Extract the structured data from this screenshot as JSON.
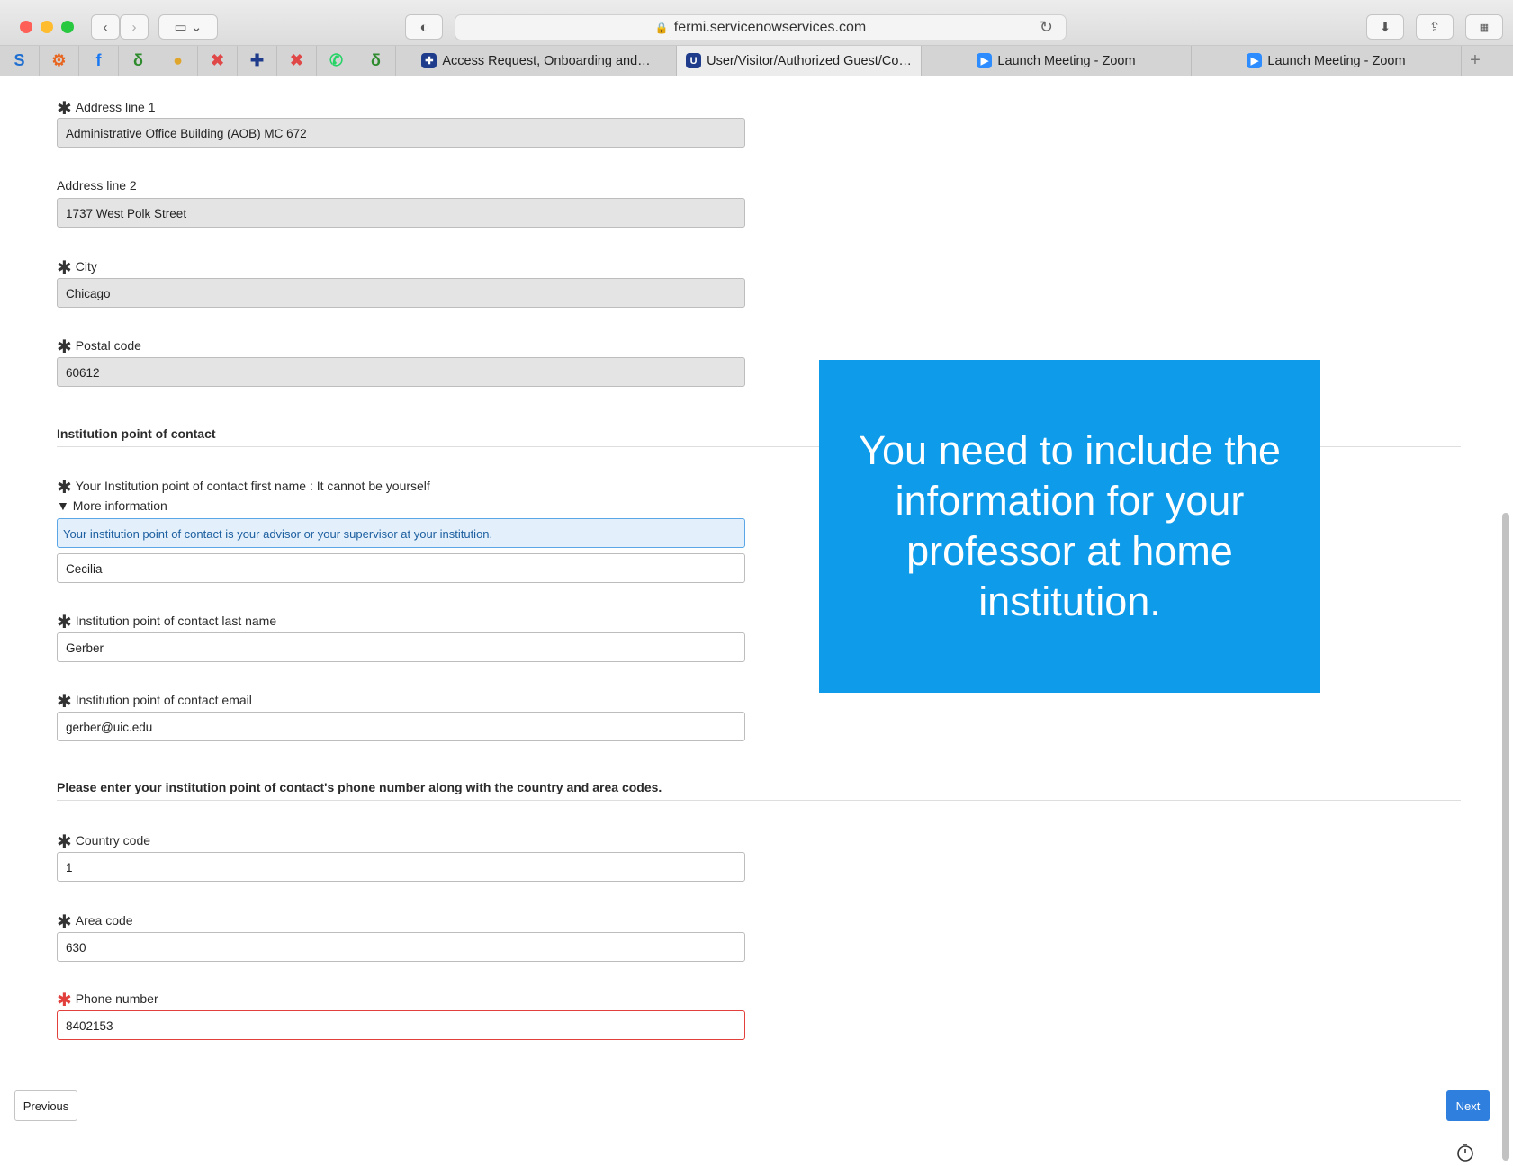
{
  "browser": {
    "url": "fermi.servicenowservices.com",
    "pinned": [
      {
        "icon": "s-icon",
        "glyph": "S",
        "color": "#1f6fd1"
      },
      {
        "icon": "gear-orange-icon",
        "glyph": "⚙",
        "color": "#e8651f"
      },
      {
        "icon": "facebook-icon",
        "glyph": "f",
        "color": "#1877f2"
      },
      {
        "icon": "sigma-icon",
        "glyph": "δ",
        "color": "#2e8b2e"
      },
      {
        "icon": "maps-pin-icon",
        "glyph": "●",
        "color": "#e0a62b"
      },
      {
        "icon": "bug-icon",
        "glyph": "✖",
        "color": "#e04848"
      },
      {
        "icon": "fermilab-icon",
        "glyph": "✚",
        "color": "#1f3c8c"
      },
      {
        "icon": "bug-icon-2",
        "glyph": "✖",
        "color": "#e04848"
      },
      {
        "icon": "whatsapp-icon",
        "glyph": "✆",
        "color": "#25d366"
      },
      {
        "icon": "sigma-icon-2",
        "glyph": "δ",
        "color": "#2e8b2e"
      }
    ],
    "tabs": [
      {
        "label": "Access Request, Onboarding and…",
        "icon": "fermilab-icon",
        "color": "#1f3c8c",
        "glyph": "✚",
        "active": false
      },
      {
        "label": "User/Visitor/Authorized Guest/Co…",
        "icon": "servicenow-icon",
        "color": "#1f3c8c",
        "glyph": "U",
        "active": true
      },
      {
        "label": "Launch Meeting - Zoom",
        "icon": "zoom-icon",
        "color": "#2d8cff",
        "glyph": "▶",
        "active": false
      },
      {
        "label": "Launch Meeting - Zoom",
        "icon": "zoom-icon",
        "color": "#2d8cff",
        "glyph": "▶",
        "active": false
      }
    ]
  },
  "form": {
    "address1": {
      "label": "Address line 1",
      "value": "Administrative Office Building (AOB) MC 672"
    },
    "address2": {
      "label": "Address line 2",
      "value": "1737 West Polk Street"
    },
    "city": {
      "label": "City",
      "value": "Chicago"
    },
    "postal": {
      "label": "Postal code",
      "value": "60612"
    },
    "contact_section": "Institution point of contact",
    "contact_first": {
      "label": "Your Institution point of contact first name : It cannot be yourself",
      "value": "Cecilia"
    },
    "more_info": "More information",
    "info_text": "Your institution point of contact is your advisor or your supervisor at your institution.",
    "contact_last": {
      "label": "Institution point of contact last name",
      "value": "Gerber"
    },
    "contact_email": {
      "label": "Institution point of contact email",
      "value": "gerber@uic.edu"
    },
    "phone_section": "Please enter your institution point of contact's phone number along with the country and area codes.",
    "country_code": {
      "label": "Country code",
      "value": "1"
    },
    "area_code": {
      "label": "Area code",
      "value": "630"
    },
    "phone": {
      "label": "Phone number",
      "value": "8402153"
    }
  },
  "callout": "You need to include the information for your professor at home institution.",
  "buttons": {
    "previous": "Previous",
    "next": "Next"
  }
}
